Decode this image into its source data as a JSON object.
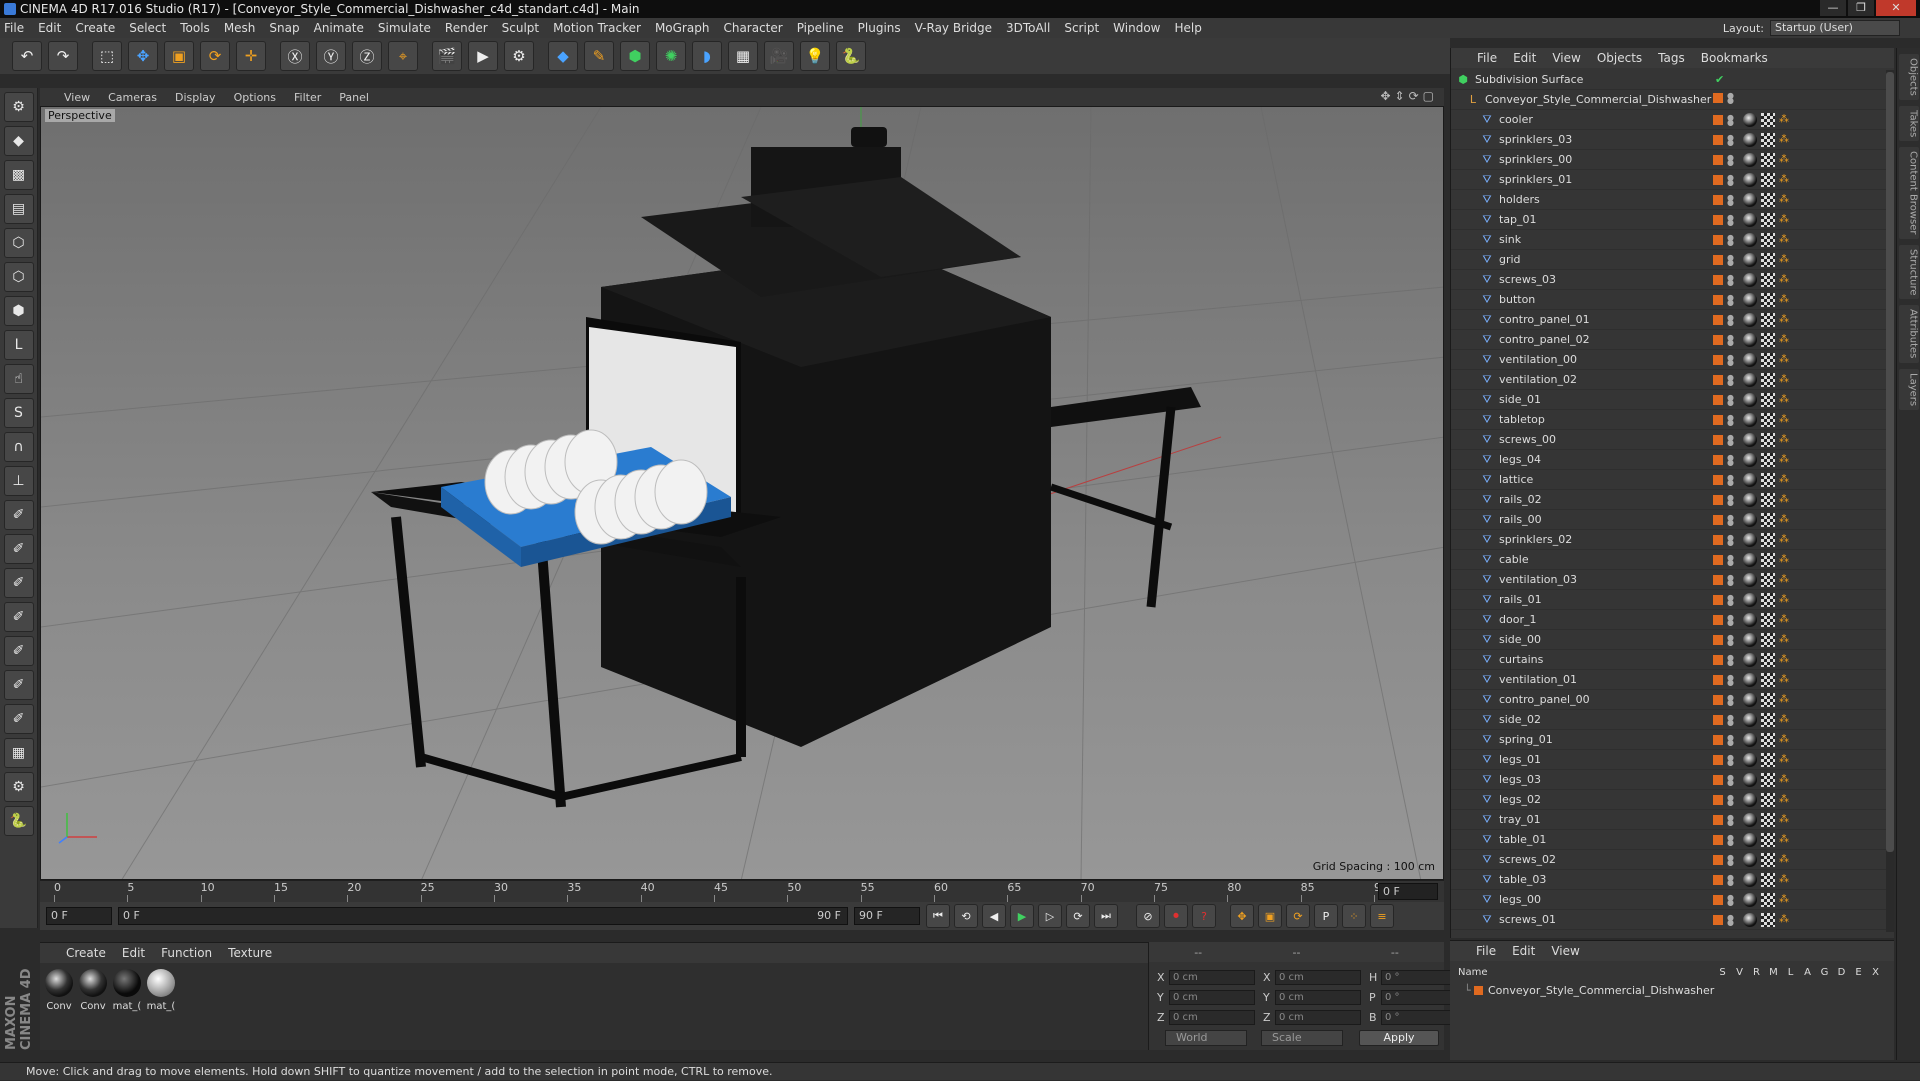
{
  "window": {
    "title": "CINEMA 4D R17.016 Studio (R17) - [Conveyor_Style_Commercial_Dishwasher_c4d_standart.c4d] - Main"
  },
  "menubar": [
    "File",
    "Edit",
    "Create",
    "Select",
    "Tools",
    "Mesh",
    "Snap",
    "Animate",
    "Simulate",
    "Render",
    "Sculpt",
    "Motion Tracker",
    "MoGraph",
    "Character",
    "Pipeline",
    "Plugins",
    "V-Ray Bridge",
    "3DToAll",
    "Script",
    "Window",
    "Help"
  ],
  "layout": {
    "label": "Layout:",
    "value": "Startup (User)"
  },
  "viewport": {
    "menu": [
      "View",
      "Cameras",
      "Display",
      "Options",
      "Filter",
      "Panel"
    ],
    "label": "Perspective",
    "grid_spacing": "Grid Spacing : 100 cm"
  },
  "timeline": {
    "ticks": [
      "0",
      "5",
      "10",
      "15",
      "20",
      "25",
      "30",
      "35",
      "40",
      "45",
      "50",
      "55",
      "60",
      "65",
      "70",
      "75",
      "80",
      "85",
      "90"
    ],
    "current": "0 F"
  },
  "playbar": {
    "start": "0 F",
    "range_start": "0 F",
    "range_end": "90 F",
    "end": "90 F"
  },
  "materials": {
    "menu": [
      "Create",
      "Edit",
      "Function",
      "Texture"
    ],
    "items": [
      {
        "label": "Conv",
        "style": "tex"
      },
      {
        "label": "Conv",
        "style": "tex"
      },
      {
        "label": "mat_(",
        "style": "dark"
      },
      {
        "label": "mat_(",
        "style": "light"
      }
    ]
  },
  "coords": {
    "head": [
      "--",
      "--",
      "--"
    ],
    "rows": [
      {
        "a": "X",
        "av": "0 cm",
        "b": "X",
        "bv": "0 cm",
        "c": "H",
        "cv": "0 °"
      },
      {
        "a": "Y",
        "av": "0 cm",
        "b": "Y",
        "bv": "0 cm",
        "c": "P",
        "cv": "0 °"
      },
      {
        "a": "Z",
        "av": "0 cm",
        "b": "Z",
        "bv": "0 cm",
        "c": "B",
        "cv": "0 °"
      }
    ],
    "mode": "World",
    "scale": "Scale",
    "apply": "Apply"
  },
  "objects": {
    "menu": [
      "File",
      "Edit",
      "View",
      "Objects",
      "Tags",
      "Bookmarks"
    ],
    "root": "Subdivision Surface",
    "group": "Conveyor_Style_Commercial_Dishwasher",
    "items": [
      "cooler",
      "sprinklers_03",
      "sprinklers_00",
      "sprinklers_01",
      "holders",
      "tap_01",
      "sink",
      "grid",
      "screws_03",
      "button",
      "contro_panel_01",
      "contro_panel_02",
      "ventilation_00",
      "ventilation_02",
      "side_01",
      "tabletop",
      "screws_00",
      "legs_04",
      "lattice",
      "rails_02",
      "rails_00",
      "sprinklers_02",
      "cable",
      "ventilation_03",
      "rails_01",
      "door_1",
      "side_00",
      "curtains",
      "ventilation_01",
      "contro_panel_00",
      "side_02",
      "spring_01",
      "legs_01",
      "legs_03",
      "legs_02",
      "tray_01",
      "table_01",
      "screws_02",
      "table_03",
      "legs_00",
      "screws_01"
    ]
  },
  "layers": {
    "menu": [
      "File",
      "Edit",
      "View"
    ],
    "name_header": "Name",
    "cols": [
      "S",
      "V",
      "R",
      "M",
      "L",
      "A",
      "G",
      "D",
      "E",
      "X"
    ],
    "row": "Conveyor_Style_Commercial_Dishwasher"
  },
  "side_tabs": [
    "Objects",
    "Takes",
    "Content Browser",
    "Structure",
    "Attributes",
    "Layers"
  ],
  "status": "Move: Click and drag to move elements. Hold down SHIFT to quantize movement / add to the selection in point mode, CTRL to remove.",
  "colors": {
    "accent": "#e06a20",
    "selection": "#4aa3ff"
  }
}
